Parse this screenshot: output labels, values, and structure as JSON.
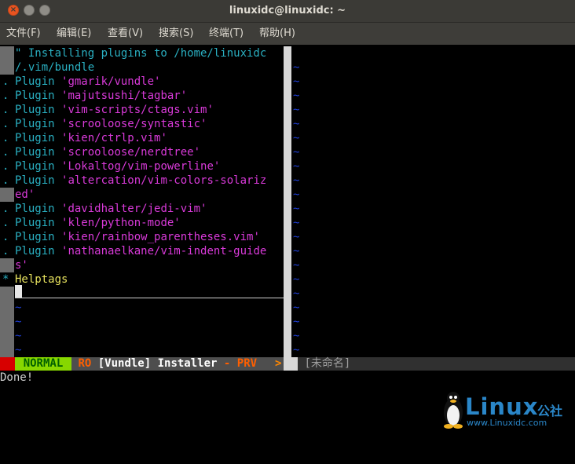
{
  "window": {
    "title": "linuxidc@linuxidc: ~",
    "close_glyph": "×"
  },
  "menu": [
    "文件(F)",
    "编辑(E)",
    "查看(V)",
    "搜索(S)",
    "终端(T)",
    "帮助(H)"
  ],
  "vundle": {
    "comment_line1": "\" Installing plugins to /home/linuxidc",
    "comment_line2": "/.vim/bundle",
    "keyword": "Plugin",
    "plugins": [
      "'gmarik/vundle'",
      "'majutsushi/tagbar'",
      "'vim-scripts/ctags.vim'",
      "'scrooloose/syntastic'",
      "'kien/ctrlp.vim'",
      "'scrooloose/nerdtree'",
      "'Lokaltog/vim-powerline'",
      "'altercation/vim-colors-solariz",
      "ed'",
      "'davidhalter/jedi-vim'",
      "'klen/python-mode'",
      "'kien/rainbow_parentheses.vim'",
      "'nathanaelkane/vim-indent-guide",
      "s'"
    ],
    "helptags": "Helptags",
    "dot": ".",
    "star": "*",
    "tilde": "~"
  },
  "statusline": {
    "mode": "NORMAL",
    "ro": "RO",
    "file": "[Vundle] Installer",
    "dash": "-",
    "prv": "PRV",
    "arrow": ">",
    "right": "[未命名]"
  },
  "cmdline": "Done!",
  "watermark": {
    "brand": "Linux",
    "cn": "公社",
    "url": "www.Linuxidc.com"
  }
}
